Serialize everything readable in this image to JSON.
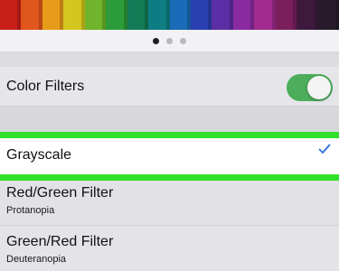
{
  "pencils": [
    "#c81f1a",
    "#e0561c",
    "#e89b1a",
    "#d3c61d",
    "#6fb42a",
    "#2c9b3a",
    "#127a55",
    "#0e7d83",
    "#1a6bb8",
    "#2a3fb0",
    "#5c2ea6",
    "#8a2aa0",
    "#a12b8f",
    "#7a1f5c",
    "#3d1a3d",
    "#271b2b"
  ],
  "pager": {
    "dots": 3,
    "active_index": 0
  },
  "color_filters": {
    "label": "Color Filters",
    "toggle_on": true,
    "toggle_color": "#4cad5a"
  },
  "filters": [
    {
      "title": "Grayscale",
      "subtitle": "",
      "selected": true,
      "highlight_color": "#31e02b",
      "check_color": "#2f6fd6"
    },
    {
      "title": "Red/Green Filter",
      "subtitle": "Protanopia",
      "selected": false
    },
    {
      "title": "Green/Red Filter",
      "subtitle": "Deuteranopia",
      "selected": false
    }
  ]
}
